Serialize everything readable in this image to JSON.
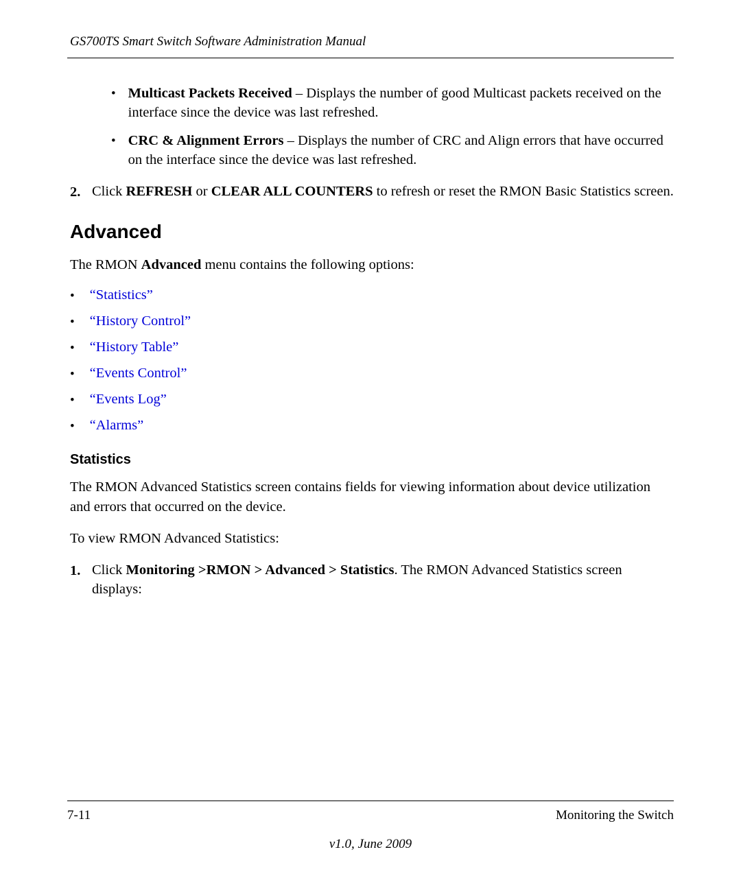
{
  "header": {
    "title": "GS700TS Smart Switch Software Administration Manual"
  },
  "topBullets": [
    {
      "boldLabel": "Multicast Packets Received",
      "sep": " – ",
      "desc": "Displays the number of good Multicast packets received on the interface since the device was last refreshed."
    },
    {
      "boldLabel": "CRC & Alignment Errors",
      "sep": " – ",
      "desc": "Displays the number of CRC and Align errors that have occurred on the interface since the device was last refreshed."
    }
  ],
  "step2": {
    "num": "2.",
    "pre": "Click ",
    "bold1": "REFRESH",
    "mid": " or ",
    "bold2": "CLEAR ALL COUNTERS",
    "post": " to refresh or reset the RMON Basic Statistics screen."
  },
  "advanced": {
    "heading": "Advanced",
    "intro_pre": "The RMON ",
    "intro_bold": "Advanced",
    "intro_post": " menu contains the following options:"
  },
  "links": [
    "“Statistics”",
    "“History Control”",
    "“History Table”",
    "“Events Control”",
    "“Events Log”",
    "“Alarms”"
  ],
  "statistics": {
    "heading": "Statistics",
    "para1": "The RMON Advanced Statistics screen contains fields for viewing information about device utilization and errors that occurred on the device.",
    "para2": "To view RMON Advanced Statistics:",
    "step1": {
      "num": "1.",
      "pre": "Click ",
      "bold": "Monitoring >RMON > Advanced > Statistics",
      "post": ". The RMON Advanced Statistics screen displays:"
    }
  },
  "footer": {
    "pageNum": "7-11",
    "section": "Monitoring the Switch",
    "version": "v1.0, June 2009"
  },
  "bulletChar": "•"
}
